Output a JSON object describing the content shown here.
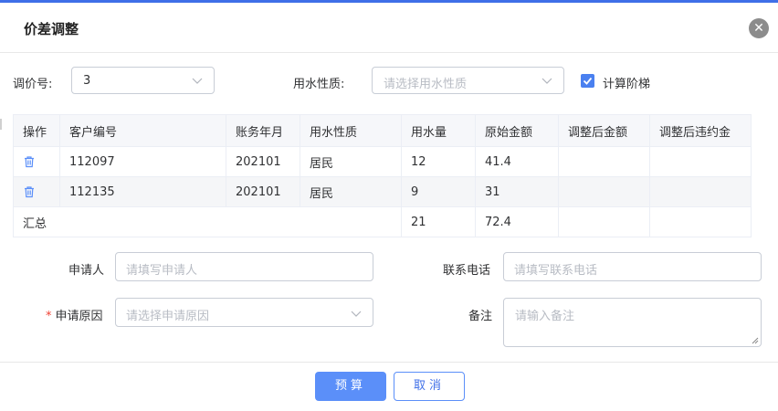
{
  "dialog": {
    "title": "价差调整",
    "close_icon": "close-icon"
  },
  "filters": {
    "price_no_label": "调价号:",
    "price_no_value": "3",
    "water_nature_label": "用水性质:",
    "water_nature_placeholder": "请选择用水性质",
    "tiered_label": "计算阶梯",
    "tiered_checked": true
  },
  "table": {
    "columns": [
      "操作",
      "客户编号",
      "账务年月",
      "用水性质",
      "用水量",
      "原始金额",
      "调整后金额",
      "调整后违约金"
    ],
    "rows": [
      {
        "customer_no": "112097",
        "account_month": "202101",
        "water_nature": "居民",
        "usage": "12",
        "original_amount": "41.4",
        "adjusted_amount": "",
        "adjusted_penalty": ""
      },
      {
        "customer_no": "112135",
        "account_month": "202101",
        "water_nature": "居民",
        "usage": "9",
        "original_amount": "31",
        "adjusted_amount": "",
        "adjusted_penalty": ""
      }
    ],
    "summary": {
      "label": "汇总",
      "usage": "21",
      "original_amount": "72.4"
    }
  },
  "form": {
    "applicant_label": "申请人",
    "applicant_placeholder": "请填写申请人",
    "phone_label": "联系电话",
    "phone_placeholder": "请填写联系电话",
    "reason_label": "申请原因",
    "reason_placeholder": "请选择申请原因",
    "reason_required": "*",
    "remark_label": "备注",
    "remark_placeholder": "请输入备注"
  },
  "footer": {
    "budget_label": "预算",
    "cancel_label": "取消"
  },
  "colors": {
    "accent": "#3f6fe8",
    "primary_button": "#5b8ff9",
    "required": "#f04134"
  }
}
